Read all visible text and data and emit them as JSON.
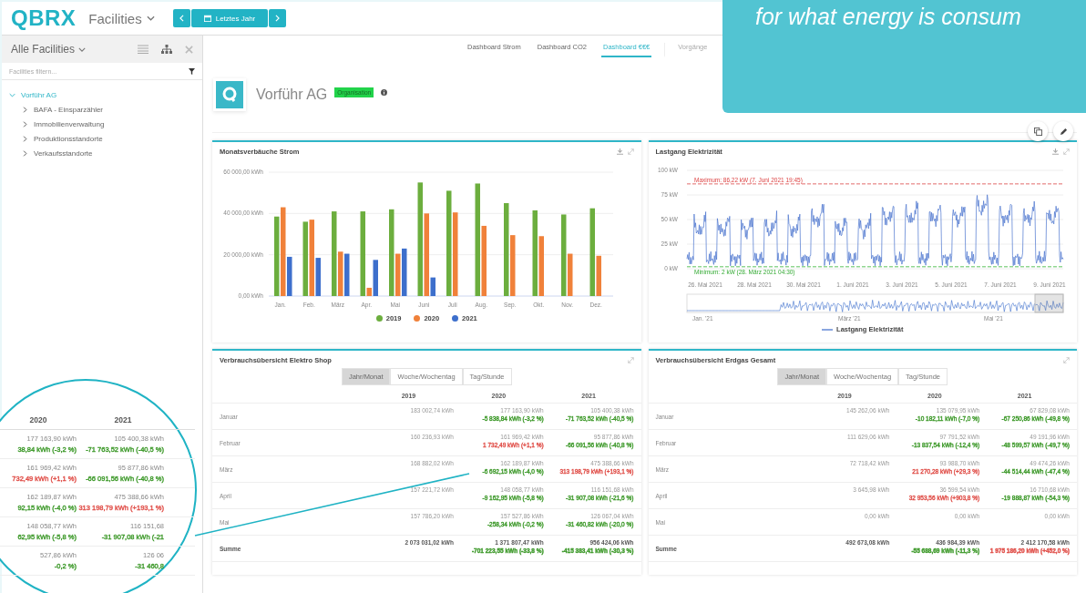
{
  "header": {
    "logo": "QBRX",
    "menu": "Facilities",
    "date_range": "Letztes Jahr"
  },
  "sidebar": {
    "title": "Alle Facilities",
    "filter_placeholder": "Facilities filtern...",
    "tree": [
      {
        "label": "Vorführ AG",
        "expanded": true,
        "children": [
          {
            "label": "BAFA - Einsparzähler",
            "expanded": false
          },
          {
            "label": "Immobilienverwaltung",
            "expanded": false
          },
          {
            "label": "Produktionsstandorte",
            "expanded": false
          },
          {
            "label": "Verkaufsstandorte",
            "expanded": false
          }
        ]
      }
    ]
  },
  "tabs": [
    {
      "label": "Dashboard Strom",
      "selected": false
    },
    {
      "label": "Dashboard CO2",
      "selected": false
    },
    {
      "label": "Dashboard €€€",
      "selected": true
    },
    {
      "label": "Vorgänge",
      "selected": false
    }
  ],
  "facility": {
    "name": "Vorführ AG",
    "badge": "Organisation"
  },
  "callout": {
    "text": "for what energy is consum"
  },
  "bar_card": {
    "title": "Monatsverbäuche Strom",
    "chart_data": {
      "type": "bar",
      "legend": "bottom",
      "categories": [
        "Jan.",
        "Feb.",
        "März",
        "Apr.",
        "Mai",
        "Juni",
        "Juli",
        "Aug.",
        "Sep.",
        "Okt.",
        "Nov.",
        "Dez."
      ],
      "ylim": [
        0,
        60000
      ],
      "yticks": [
        {
          "value": 0,
          "label": "0,00 kWh"
        },
        {
          "value": 20000,
          "label": "20 000,00 kWh"
        },
        {
          "value": 40000,
          "label": "40 000,00 kWh"
        },
        {
          "value": 60000,
          "label": "60 000,00 kWh"
        }
      ],
      "series": [
        {
          "name": "2019",
          "color": "#6cae3e",
          "values": [
            38500,
            36000,
            41000,
            41000,
            42000,
            55000,
            51000,
            54500,
            45000,
            41500,
            39500,
            42500
          ]
        },
        {
          "name": "2020",
          "color": "#f0813a",
          "values": [
            43000,
            37000,
            21500,
            4000,
            20500,
            40000,
            40500,
            34000,
            29500,
            29000,
            20500,
            19500
          ]
        },
        {
          "name": "2021",
          "color": "#3d6fcc",
          "values": [
            19000,
            18500,
            20500,
            17500,
            23000,
            9000,
            null,
            null,
            null,
            null,
            null,
            null
          ]
        }
      ]
    }
  },
  "load_card": {
    "title": "Lastgang Elektrizität",
    "y_labels": [
      "100 kW",
      "75 kW",
      "50 kW",
      "25 kW",
      "0 kW"
    ],
    "x_labels": [
      "26. Mai 2021",
      "28. Mai 2021",
      "30. Mai 2021",
      "1. Juni 2021",
      "3. Juni 2021",
      "5. Juni 2021",
      "7. Juni 2021",
      "9. Juni 2021"
    ],
    "max_label": "Maximum: 86,22 kW (7. Juni 2021 19:45)",
    "min_label": "Minimum: 2 kW (28. März 2021 04:30)",
    "nav_labels": [
      "Jan. '21",
      "März '21",
      "Mai '21"
    ],
    "legend": "Lastgang Elektrizität"
  },
  "tables": [
    {
      "title": "Verbrauchsübersicht Elektro Shop",
      "segments": [
        {
          "label": "Jahr/Monat",
          "selected": true
        },
        {
          "label": "Woche/Wochentag",
          "selected": false
        },
        {
          "label": "Tag/Stunde",
          "selected": false
        }
      ],
      "columns": [
        "2019",
        "2020",
        "2021"
      ],
      "rows": [
        {
          "label": "Januar",
          "cells": [
            {
              "value": "183 002,74 kWh"
            },
            {
              "value": "177 163,90 kWh",
              "delta": "-5 838,84 kWh (-3,2 %)",
              "color": "#3f9a2c"
            },
            {
              "value": "105 400,38 kWh",
              "delta": "-71 763,52 kWh (-40,5 %)",
              "color": "#3f9a2c"
            }
          ]
        },
        {
          "label": "Februar",
          "cells": [
            {
              "value": "160 236,93 kWh"
            },
            {
              "value": "161 969,42 kWh",
              "delta": "1 732,49 kWh (+1,1 %)",
              "color": "#e0504a"
            },
            {
              "value": "95 877,86 kWh",
              "delta": "-66 091,56 kWh (-40,8 %)",
              "color": "#3f9a2c"
            }
          ]
        },
        {
          "label": "März",
          "cells": [
            {
              "value": "168 882,02 kWh"
            },
            {
              "value": "162 189,87 kWh",
              "delta": "-6 692,15 kWh (-4,0 %)",
              "color": "#3f9a2c"
            },
            {
              "value": "475 388,66 kWh",
              "delta": "313 198,79 kWh (+193,1 %)",
              "color": "#e0504a"
            }
          ]
        },
        {
          "label": "April",
          "cells": [
            {
              "value": "157 221,72 kWh"
            },
            {
              "value": "148 058,77 kWh",
              "delta": "-9 162,95 kWh (-5,8 %)",
              "color": "#3f9a2c"
            },
            {
              "value": "116 151,68 kWh",
              "delta": "-31 907,08 kWh (-21,6 %)",
              "color": "#3f9a2c"
            }
          ]
        },
        {
          "label": "Mai",
          "cells": [
            {
              "value": "157 786,20 kWh"
            },
            {
              "value": "157 527,86 kWh",
              "delta": "-258,34 kWh (-0,2 %)",
              "color": "#3f9a2c"
            },
            {
              "value": "126 067,04 kWh",
              "delta": "-31 460,82 kWh (-20,0 %)",
              "color": "#3f9a2c"
            }
          ]
        }
      ],
      "total": {
        "label": "Summe",
        "cells": [
          {
            "value": "2 073 031,02 kWh"
          },
          {
            "value": "1 371 807,47 kWh",
            "delta": "-701 223,55 kWh (-33,8 %)",
            "color": "#3f9a2c"
          },
          {
            "value": "956 424,06 kWh",
            "delta": "-415 383,41 kWh (-30,3 %)",
            "color": "#3f9a2c"
          }
        ]
      }
    },
    {
      "title": "Verbrauchsübersicht Erdgas Gesamt",
      "segments": [
        {
          "label": "Jahr/Monat",
          "selected": true
        },
        {
          "label": "Woche/Wochentag",
          "selected": false
        },
        {
          "label": "Tag/Stunde",
          "selected": false
        }
      ],
      "columns": [
        "2019",
        "2020",
        "2021"
      ],
      "rows": [
        {
          "label": "Januar",
          "cells": [
            {
              "value": "145 262,06 kWh"
            },
            {
              "value": "135 079,95 kWh",
              "delta": "-10 182,11 kWh (-7,0 %)",
              "color": "#3f9a2c"
            },
            {
              "value": "67 829,08 kWh",
              "delta": "-67 250,86 kWh (-49,8 %)",
              "color": "#3f9a2c"
            }
          ]
        },
        {
          "label": "Februar",
          "cells": [
            {
              "value": "111 629,06 kWh"
            },
            {
              "value": "97 791,52 kWh",
              "delta": "-13 837,54 kWh (-12,4 %)",
              "color": "#3f9a2c"
            },
            {
              "value": "49 191,96 kWh",
              "delta": "-48 599,57 kWh (-49,7 %)",
              "color": "#3f9a2c"
            }
          ]
        },
        {
          "label": "März",
          "cells": [
            {
              "value": "72 718,42 kWh"
            },
            {
              "value": "93 988,70 kWh",
              "delta": "21 270,28 kWh (+29,3 %)",
              "color": "#e0504a"
            },
            {
              "value": "49 474,26 kWh",
              "delta": "-44 514,44 kWh (-47,4 %)",
              "color": "#3f9a2c"
            }
          ]
        },
        {
          "label": "April",
          "cells": [
            {
              "value": "3 645,98 kWh"
            },
            {
              "value": "36 599,54 kWh",
              "delta": "32 953,56 kWh (+903,8 %)",
              "color": "#e0504a"
            },
            {
              "value": "16 710,68 kWh",
              "delta": "-19 888,87 kWh (-54,3 %)",
              "color": "#3f9a2c"
            }
          ]
        },
        {
          "label": "Mai",
          "cells": [
            {
              "value": "0,00 kWh"
            },
            {
              "value": "0,00 kWh"
            },
            {
              "value": "0,00 kWh"
            }
          ]
        }
      ],
      "total": {
        "label": "Summe",
        "cells": [
          {
            "value": "492 673,08 kWh"
          },
          {
            "value": "436 984,39 kWh",
            "delta": "-55 688,69 kWh (-11,3 %)",
            "color": "#3f9a2c"
          },
          {
            "value": "2 412 170,58 kWh",
            "delta": "1 975 186,20 kWh (+452,0 %)",
            "color": "#e0504a"
          }
        ]
      }
    }
  ],
  "magnifier": {
    "columns": [
      "2020",
      "2021"
    ],
    "rows": [
      {
        "cells": [
          {
            "value": "177 163,90 kWh",
            "delta": "38,84 kWh (-3,2 %)",
            "color": "#3f9a2c"
          },
          {
            "value": "105 400,38 kWh",
            "delta": "-71 763,52 kWh (-40,5 %)",
            "color": "#3f9a2c"
          }
        ]
      },
      {
        "cells": [
          {
            "value": "161 969,42 kWh",
            "delta": "732,49 kWh (+1,1 %)",
            "color": "#e0504a"
          },
          {
            "value": "95 877,86 kWh",
            "delta": "-66 091,56 kWh (-40,8 %)",
            "color": "#3f9a2c"
          }
        ]
      },
      {
        "cells": [
          {
            "value": "162 189,87 kWh",
            "delta": "92,15 kWh (-4,0 %)",
            "color": "#3f9a2c"
          },
          {
            "value": "475 388,66 kWh",
            "delta": "313 198,79 kWh (+193,1 %)",
            "color": "#e0504a"
          }
        ]
      },
      {
        "cells": [
          {
            "value": "148 058,77 kWh",
            "delta": "62,95 kWh (-5,8 %)",
            "color": "#3f9a2c"
          },
          {
            "value": "116 151,68",
            "delta": "-31 907,08 kWh (-21",
            "color": "#3f9a2c"
          }
        ]
      },
      {
        "cells": [
          {
            "value": "527,86 kWh",
            "delta": "-0,2 %)",
            "color": "#3f9a2c"
          },
          {
            "value": "126 06",
            "delta": "-31 460,8",
            "color": "#3f9a2c"
          }
        ]
      }
    ]
  }
}
